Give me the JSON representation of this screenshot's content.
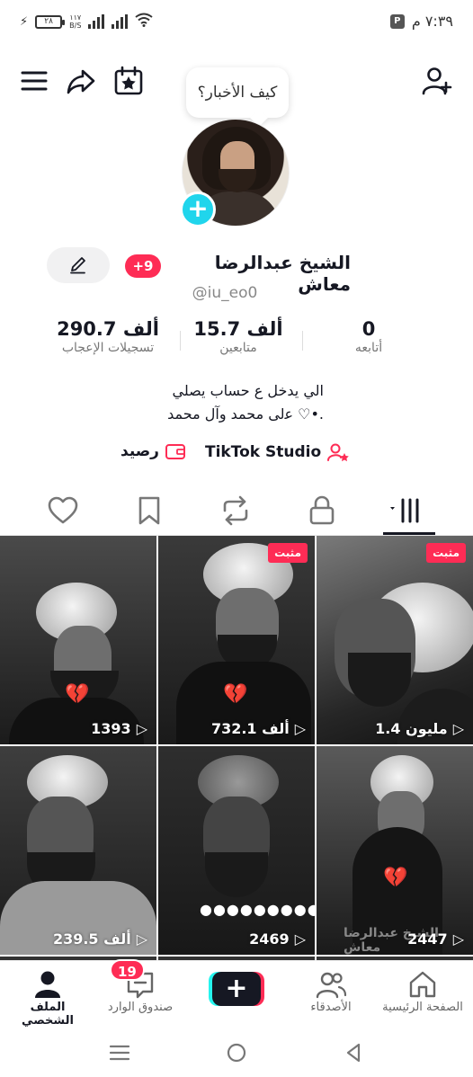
{
  "status_bar": {
    "battery": "٢٨",
    "speed_value": "١١٧",
    "speed_unit": "B/S",
    "time": "٧:٣٩ م"
  },
  "top_bar": {
    "menu_icon": "hamburger-icon",
    "share_icon": "share-arrow-icon",
    "calendar_icon": "calendar-star-icon",
    "add_friend_icon": "add-user-icon"
  },
  "bubble": {
    "text": "كيف الأخبار؟"
  },
  "profile": {
    "name": "الشيخ عبدالرضا معاش",
    "notif_badge": "+9",
    "handle": "@iu_eo0",
    "stats": {
      "following": {
        "value": "0",
        "label": "أتابعه"
      },
      "followers": {
        "value": "15.7 ألف",
        "label": "متابعين"
      },
      "likes": {
        "value": "290.7 ألف",
        "label": "تسجيلات الإعجاب"
      }
    },
    "bio_line1": "الي يدخل ع حساب يصلي",
    "bio_line2": "ﻋﻟﻰ محمد وآل محمد ♡•.",
    "studio_label": "TikTok Studio",
    "balance_label": "رصيد"
  },
  "tabs": [
    "videos",
    "private",
    "reposts",
    "saved",
    "liked"
  ],
  "videos": [
    {
      "views": "1.4 مليون",
      "pinned": "مثبت"
    },
    {
      "views": "732.1 ألف",
      "pinned": "مثبت"
    },
    {
      "views": "1393",
      "pinned": ""
    },
    {
      "views": "2447",
      "pinned": ""
    },
    {
      "views": "2469",
      "pinned": ""
    },
    {
      "views": "239.5 ألف",
      "pinned": ""
    }
  ],
  "grid_overlay": {
    "dots": "●●●●●●●●●●",
    "caption": "الشيخ عبدالرضا معاش"
  },
  "bottom_nav": {
    "home": "الصفحة الرئيسية",
    "friends": "الأصدقاء",
    "inbox": "صندوق الوارد",
    "inbox_badge": "19",
    "profile": "الملف الشخصي"
  },
  "colors": {
    "accent": "#fe2c55",
    "cyan": "#25f4ee",
    "avatar_add": "#20d5ec"
  }
}
